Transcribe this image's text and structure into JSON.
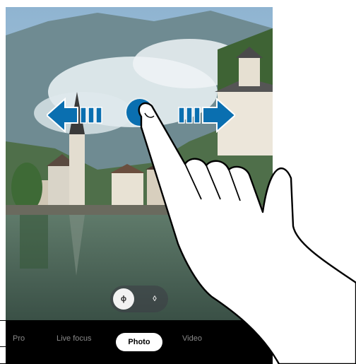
{
  "camera": {
    "modes": [
      "Pro",
      "Live focus",
      "Photo",
      "Video"
    ],
    "selected_mode": "Photo",
    "toggle": {
      "active_label": "ɸ",
      "inactive_label": "◊"
    }
  },
  "gesture": {
    "type": "swipe-left-right",
    "touch_color": "#0a6fb0"
  },
  "colors": {
    "sky": "#9ec1dc",
    "mountain": "#5d7c6e",
    "lake": "#4f6a5a",
    "mode_bar": "#000000"
  }
}
